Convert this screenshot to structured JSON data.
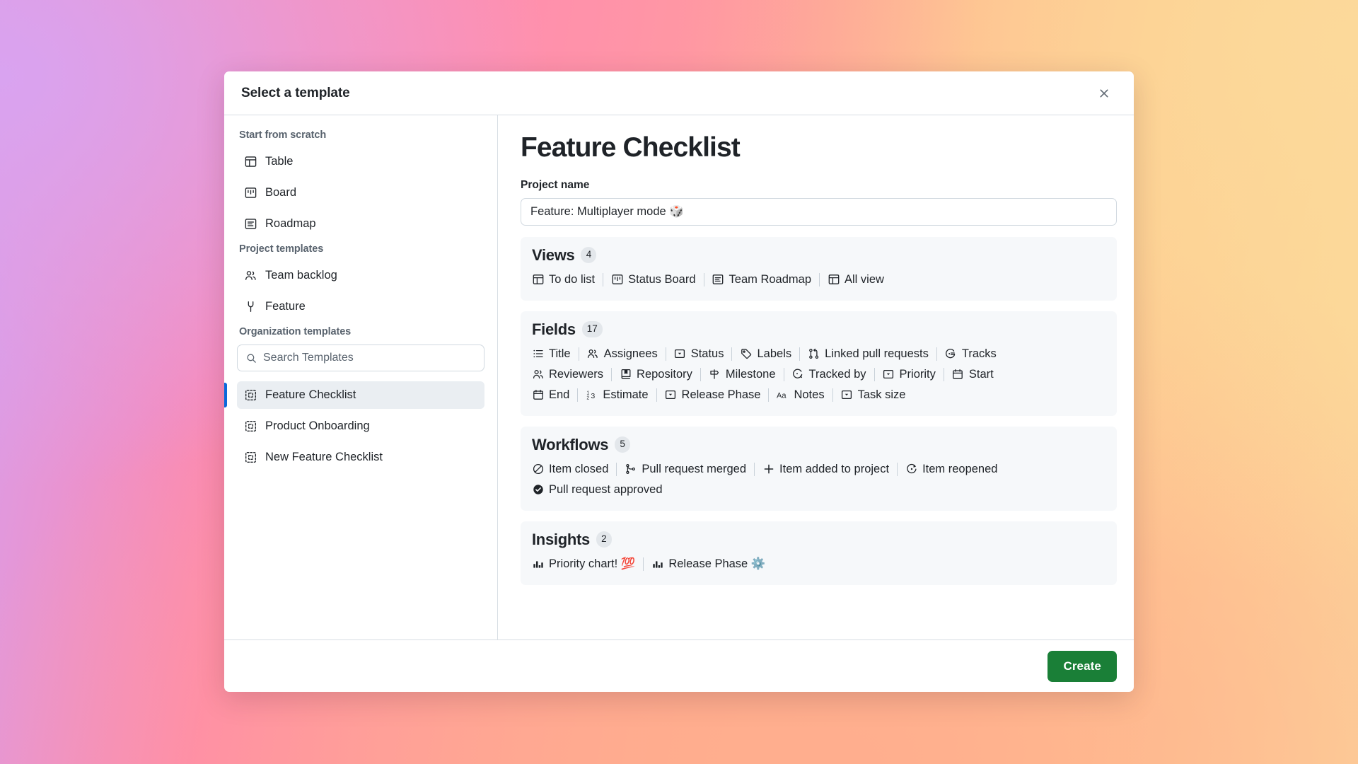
{
  "dialog": {
    "title": "Select a template",
    "close_icon": "close-icon"
  },
  "sidebar": {
    "sections": [
      {
        "title": "Start from scratch",
        "items": [
          {
            "label": "Table",
            "icon": "table-icon"
          },
          {
            "label": "Board",
            "icon": "board-icon"
          },
          {
            "label": "Roadmap",
            "icon": "roadmap-icon"
          }
        ]
      },
      {
        "title": "Project templates",
        "items": [
          {
            "label": "Team backlog",
            "icon": "people-icon"
          },
          {
            "label": "Feature",
            "icon": "tools-icon"
          }
        ]
      },
      {
        "title": "Organization templates",
        "items": [
          {
            "label": "Feature Checklist",
            "icon": "template-icon",
            "selected": true
          },
          {
            "label": "Product Onboarding",
            "icon": "template-icon",
            "selected": false
          },
          {
            "label": "New Feature Checklist",
            "icon": "template-icon",
            "selected": false
          }
        ]
      }
    ],
    "search": {
      "placeholder": "Search Templates",
      "value": "",
      "icon": "search-icon"
    }
  },
  "main": {
    "template_title": "Feature Checklist",
    "project_name": {
      "label": "Project name",
      "value": "Feature: Multiplayer mode 🎲",
      "placeholder": "Project name"
    },
    "sections": [
      {
        "heading": "Views",
        "count": "4",
        "items": [
          {
            "label": "To do list",
            "icon": "table-icon"
          },
          {
            "label": "Status Board",
            "icon": "board-icon"
          },
          {
            "label": "Team Roadmap",
            "icon": "roadmap-icon"
          },
          {
            "label": "All view",
            "icon": "table-icon"
          }
        ]
      },
      {
        "heading": "Fields",
        "count": "17",
        "items": [
          {
            "label": "Title",
            "icon": "list-icon"
          },
          {
            "label": "Assignees",
            "icon": "people-icon"
          },
          {
            "label": "Status",
            "icon": "single-select-icon"
          },
          {
            "label": "Labels",
            "icon": "tag-icon"
          },
          {
            "label": "Linked pull requests",
            "icon": "git-pull-request-icon"
          },
          {
            "label": "Tracks",
            "icon": "tracks-icon"
          },
          {
            "label": "Reviewers",
            "icon": "people-icon"
          },
          {
            "label": "Repository",
            "icon": "repo-icon"
          },
          {
            "label": "Milestone",
            "icon": "milestone-icon"
          },
          {
            "label": "Tracked by",
            "icon": "tracked-by-icon"
          },
          {
            "label": "Priority",
            "icon": "single-select-icon"
          },
          {
            "label": "Start",
            "icon": "calendar-icon"
          },
          {
            "label": "End",
            "icon": "calendar-icon"
          },
          {
            "label": "Estimate",
            "icon": "number-icon"
          },
          {
            "label": "Release Phase",
            "icon": "single-select-icon"
          },
          {
            "label": "Notes",
            "icon": "text-icon"
          },
          {
            "label": "Task size",
            "icon": "single-select-icon"
          }
        ]
      },
      {
        "heading": "Workflows",
        "count": "5",
        "items": [
          {
            "label": "Item closed",
            "icon": "skip-circle-icon"
          },
          {
            "label": "Pull request merged",
            "icon": "git-merge-icon"
          },
          {
            "label": "Item added to project",
            "icon": "plus-icon"
          },
          {
            "label": "Item reopened",
            "icon": "issue-reopened-icon"
          },
          {
            "label": "Pull request approved",
            "icon": "check-circle-fill-icon"
          }
        ]
      },
      {
        "heading": "Insights",
        "count": "2",
        "items": [
          {
            "label": "Priority chart! 💯",
            "icon": "chart-icon"
          },
          {
            "label": "Release Phase ⚙️",
            "icon": "chart-icon"
          }
        ]
      }
    ]
  },
  "footer": {
    "create_label": "Create"
  },
  "colors": {
    "accent": "#0969da",
    "create_button": "#1a7f37",
    "card_bg": "#f6f8fa",
    "border": "#d8dee4"
  }
}
